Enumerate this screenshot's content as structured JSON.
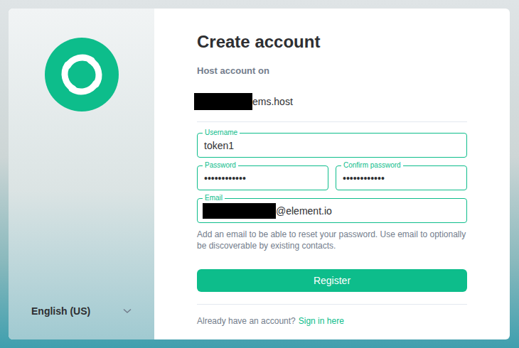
{
  "title": "Create account",
  "host": {
    "label": "Host account on",
    "redacted": true,
    "visible_text": "ems.host"
  },
  "field_rows": [
    [
      {
        "label": "Username",
        "value": "token1",
        "redacted": false
      }
    ],
    [
      {
        "label": "Password",
        "value": "••••••••••••",
        "redacted": false
      },
      {
        "label": "Confirm password",
        "value": "••••••••••••",
        "redacted": false
      }
    ],
    [
      {
        "label": "Email",
        "value": "@element.io",
        "redacted": true
      }
    ]
  ],
  "helper": "Add an email to be able to reset your password. Use email to optionally be discoverable by existing contacts.",
  "submit": "Register",
  "footer": {
    "text": "Already have an account?",
    "link": "Sign in here"
  },
  "language": {
    "label": "English (US)"
  }
}
